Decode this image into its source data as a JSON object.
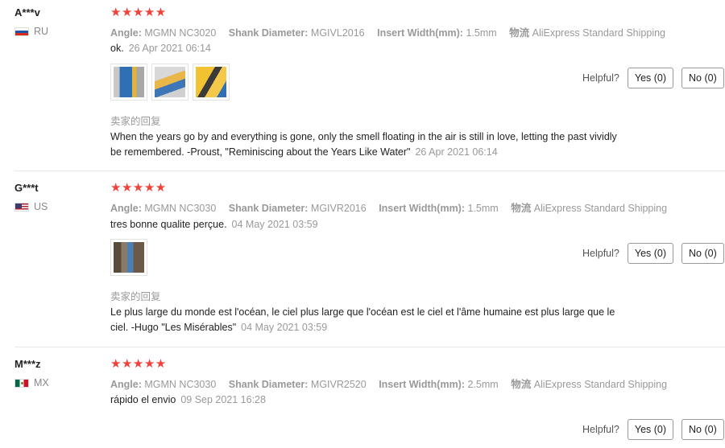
{
  "labels": {
    "helpful": "Helpful?",
    "yes": "Yes (0)",
    "no": "No (0)",
    "seller_reply_title": "卖家的回复"
  },
  "reviews": [
    {
      "user": "A***v",
      "country": "RU",
      "stars": "★★★★★",
      "angle_label": "Angle:",
      "angle": "MGMN NC3020",
      "shank_label": "Shank Diameter:",
      "shank": "MGIVL2016",
      "width_label": "Insert Width(mm):",
      "width": "1.5mm",
      "shipping_label": "物流",
      "shipping": "AliExpress Standard Shipping",
      "comment": "ok.",
      "date": "26 Apr 2021 06:14",
      "reply": "When the years go by and everything is gone, only the smell floating in the air is still in love, letting the past vividly be remembered. -Proust, \"Reminiscing about the Years Like Water\"",
      "reply_date": "26 Apr 2021 06:14"
    },
    {
      "user": "G***t",
      "country": "US",
      "stars": "★★★★★",
      "angle_label": "Angle:",
      "angle": "MGMN NC3030",
      "shank_label": "Shank Diameter:",
      "shank": "MGIVR2016",
      "width_label": "Insert Width(mm):",
      "width": "1.5mm",
      "shipping_label": "物流",
      "shipping": "AliExpress Standard Shipping",
      "comment": "tres bonne qualite perçue.",
      "date": "04 May 2021 03:59",
      "reply": "Le plus large du monde est l'océan, le ciel plus large que l'océan est le ciel et l'âme humaine est plus large que le ciel. -Hugo \"Les Misérables\"",
      "reply_date": "04 May 2021 03:59"
    },
    {
      "user": "M***z",
      "country": "MX",
      "stars": "★★★★★",
      "angle_label": "Angle:",
      "angle": "MGMN NC3030",
      "shank_label": "Shank Diameter:",
      "shank": "MGIVR2520",
      "width_label": "Insert Width(mm):",
      "width": "2.5mm",
      "shipping_label": "物流",
      "shipping": "AliExpress Standard Shipping",
      "comment": "rápido el envio",
      "date": "09 Sep 2021 16:28"
    }
  ]
}
